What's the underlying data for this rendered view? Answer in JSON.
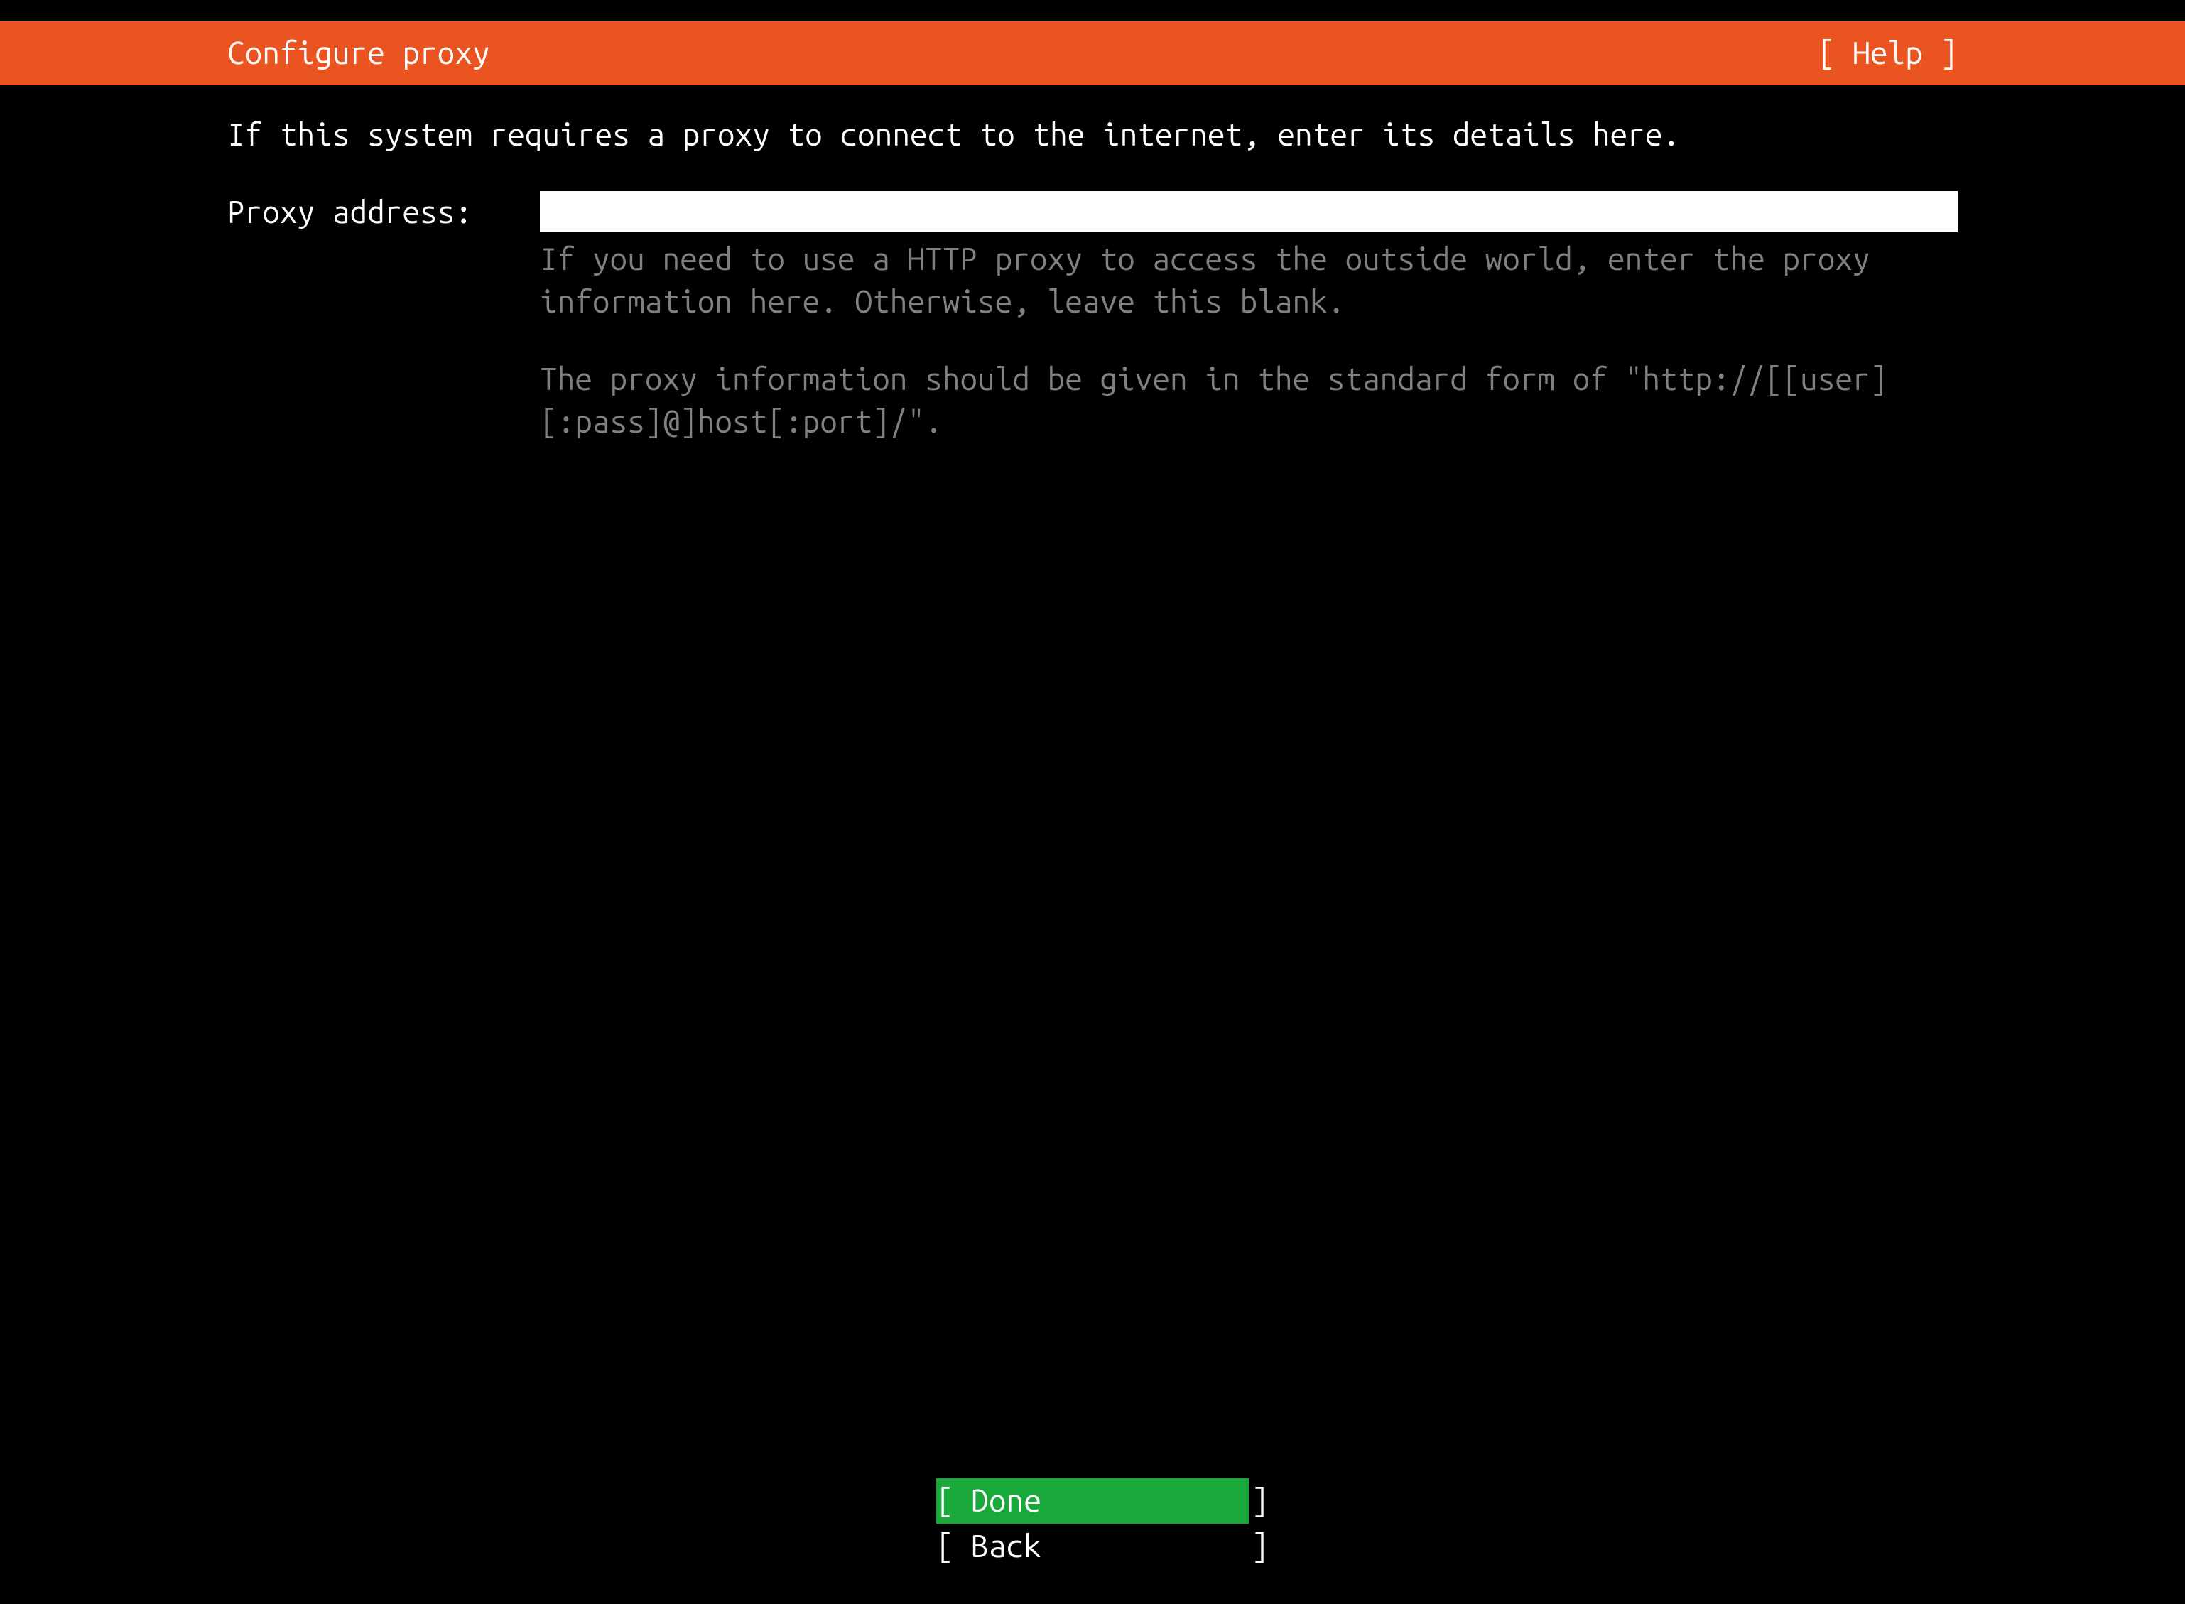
{
  "header": {
    "title": "Configure proxy",
    "help": "[ Help ]"
  },
  "content": {
    "intro": "If this system requires a proxy to connect to the internet, enter its details here.",
    "field_label": "Proxy address:",
    "field_value": "",
    "help_para1": "If you need to use a HTTP proxy to access the outside world, enter the proxy information here. Otherwise, leave this blank.",
    "help_para2": "The proxy information should be given in the standard form of \"http://[[user][:pass]@]host[:port]/\"."
  },
  "buttons": {
    "done": "[ Done            ]",
    "back": "[ Back            ]"
  },
  "colors": {
    "accent": "#e95420",
    "selected": "#19a83a",
    "bg": "#000000",
    "fg": "#ffffff",
    "muted": "#808080"
  }
}
